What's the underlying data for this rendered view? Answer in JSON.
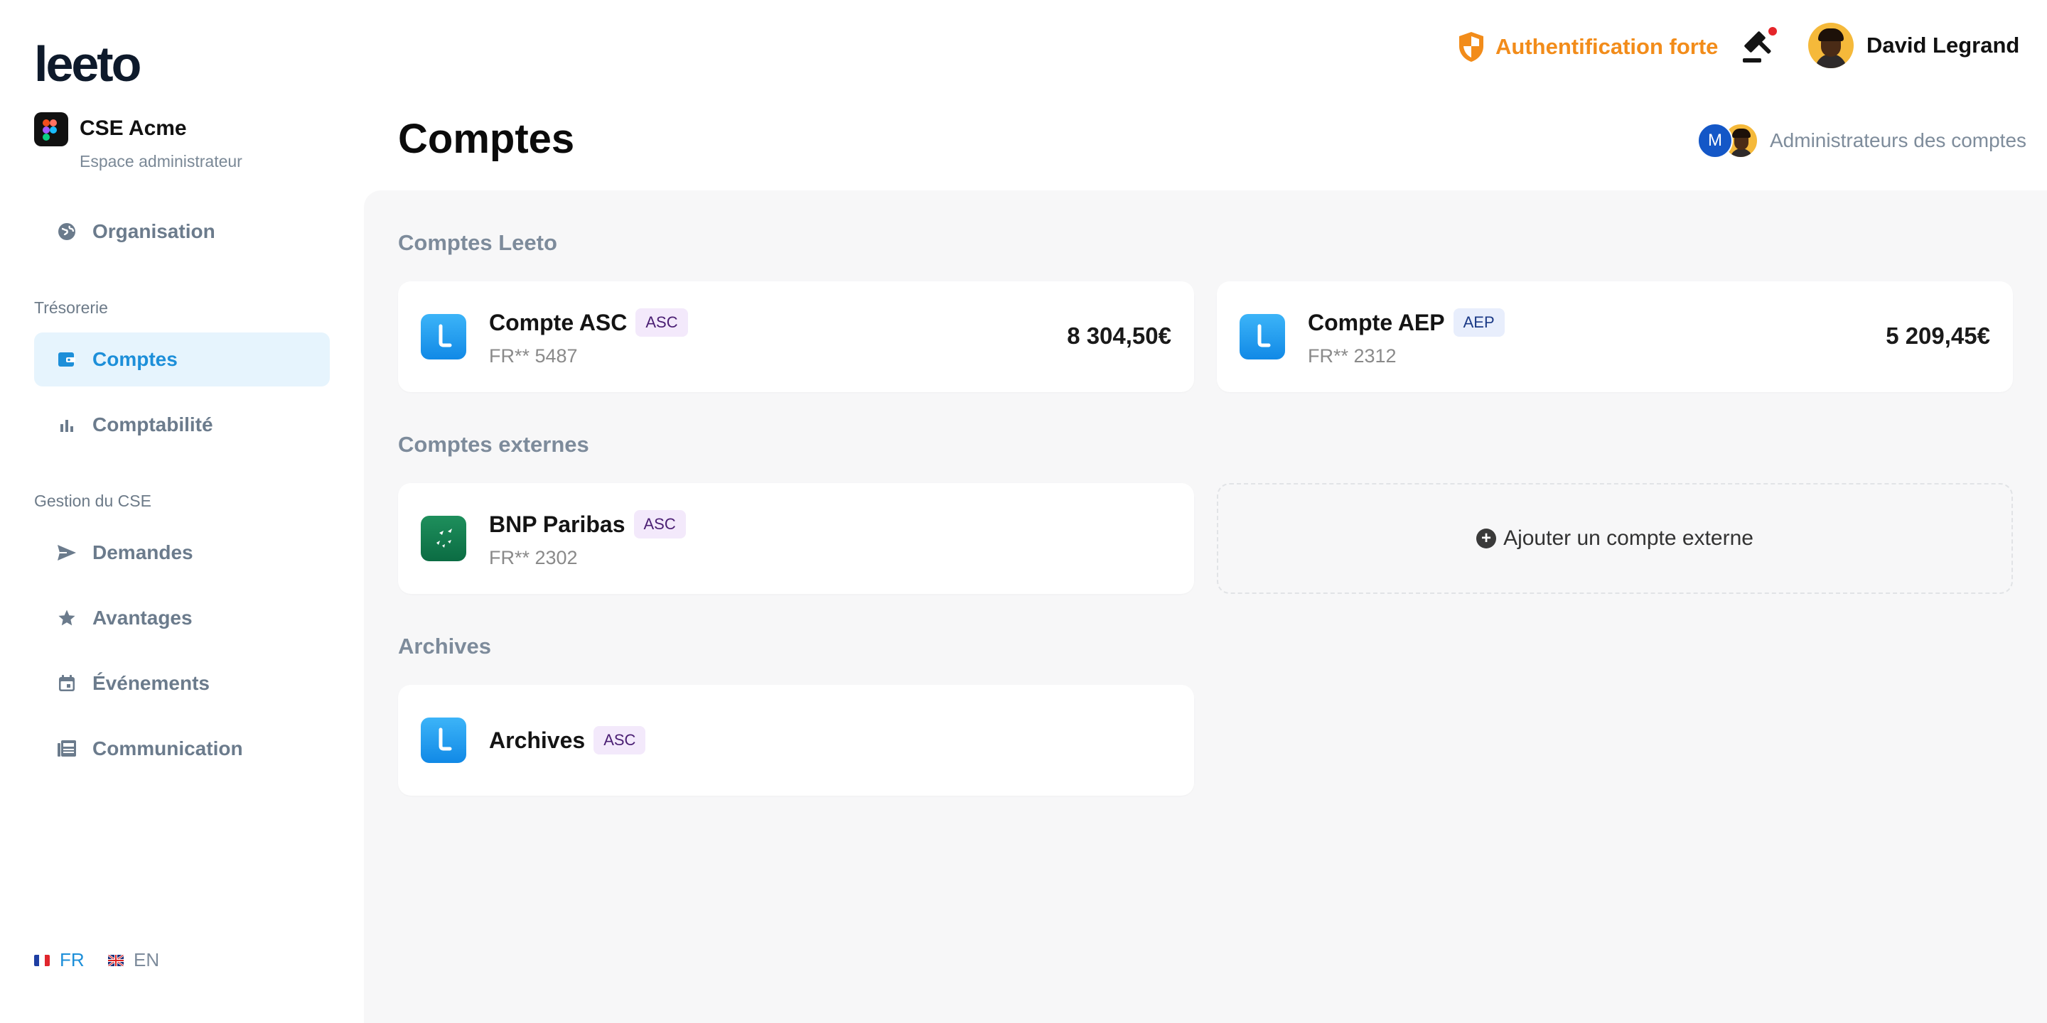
{
  "brand": {
    "logo_text": "leeto"
  },
  "organization": {
    "name": "CSE Acme",
    "subtitle": "Espace administrateur"
  },
  "sidebar": {
    "top_items": [
      {
        "label": "Organisation",
        "icon": "globe-icon"
      }
    ],
    "sections": [
      {
        "title": "Trésorerie",
        "items": [
          {
            "label": "Comptes",
            "icon": "wallet-icon",
            "active": true
          },
          {
            "label": "Comptabilité",
            "icon": "bar-chart-icon",
            "active": false
          }
        ]
      },
      {
        "title": "Gestion du CSE",
        "items": [
          {
            "label": "Demandes",
            "icon": "send-icon"
          },
          {
            "label": "Avantages",
            "icon": "star-icon"
          },
          {
            "label": "Événements",
            "icon": "calendar-icon"
          },
          {
            "label": "Communication",
            "icon": "newspaper-icon"
          }
        ]
      }
    ],
    "languages": [
      {
        "code": "FR",
        "active": true
      },
      {
        "code": "EN",
        "active": false
      }
    ]
  },
  "topbar": {
    "auth_label": "Authentification forte",
    "user_name": "David Legrand"
  },
  "page": {
    "title": "Comptes",
    "admins_label": "Administrateurs des comptes",
    "admin_initial": "M"
  },
  "sections": {
    "leeto": {
      "title": "Comptes Leeto",
      "accounts": [
        {
          "name": "Compte ASC",
          "badge": "ASC",
          "iban": "FR** 5487",
          "amount": "8 304,50€"
        },
        {
          "name": "Compte AEP",
          "badge": "AEP",
          "iban": "FR** 2312",
          "amount": "5 209,45€"
        }
      ]
    },
    "external": {
      "title": "Comptes externes",
      "accounts": [
        {
          "name": "BNP Paribas",
          "badge": "ASC",
          "iban": "FR** 2302"
        }
      ],
      "add_label": "Ajouter un compte externe"
    },
    "archives": {
      "title": "Archives",
      "accounts": [
        {
          "name": "Archives",
          "badge": "ASC"
        }
      ]
    }
  },
  "colors": {
    "accent": "#1d8fd9",
    "warning": "#f28c1a",
    "active_bg": "#e6f4fd"
  }
}
